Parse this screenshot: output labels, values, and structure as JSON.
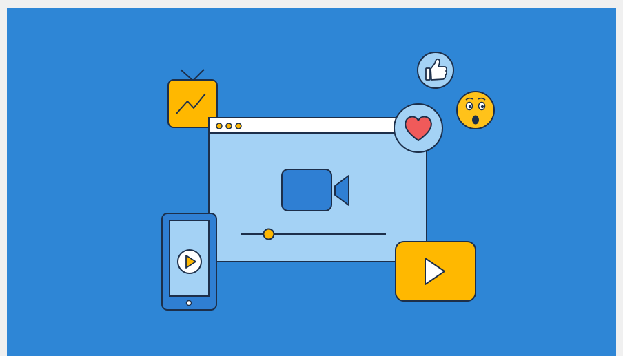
{
  "colors": {
    "page_background": "#f0f0f0",
    "canvas_background": "#2e86d6",
    "outline": "#1d2f4a",
    "window_fill": "#a4d2f5",
    "window_titlebar": "#ffffff",
    "accent_yellow": "#ffb800",
    "camera_blue": "#2f7fd3",
    "heart_red": "#f05a5a",
    "badge_fill": "#a4d2f5",
    "emoji_yellow": "#ffc21a"
  },
  "illustration": {
    "window": {
      "dots": 3,
      "icon": "video-camera-icon"
    },
    "player": {
      "progress": 0.19
    },
    "tv": {
      "icon": "tv-zigzag-icon"
    },
    "phone": {
      "icon": "play-circle-icon"
    },
    "play_card": {
      "icon": "play-triangle-icon"
    },
    "badges": [
      {
        "icon": "heart-icon"
      },
      {
        "icon": "thumbs-up-icon"
      },
      {
        "icon": "surprised-face-icon"
      }
    ]
  }
}
